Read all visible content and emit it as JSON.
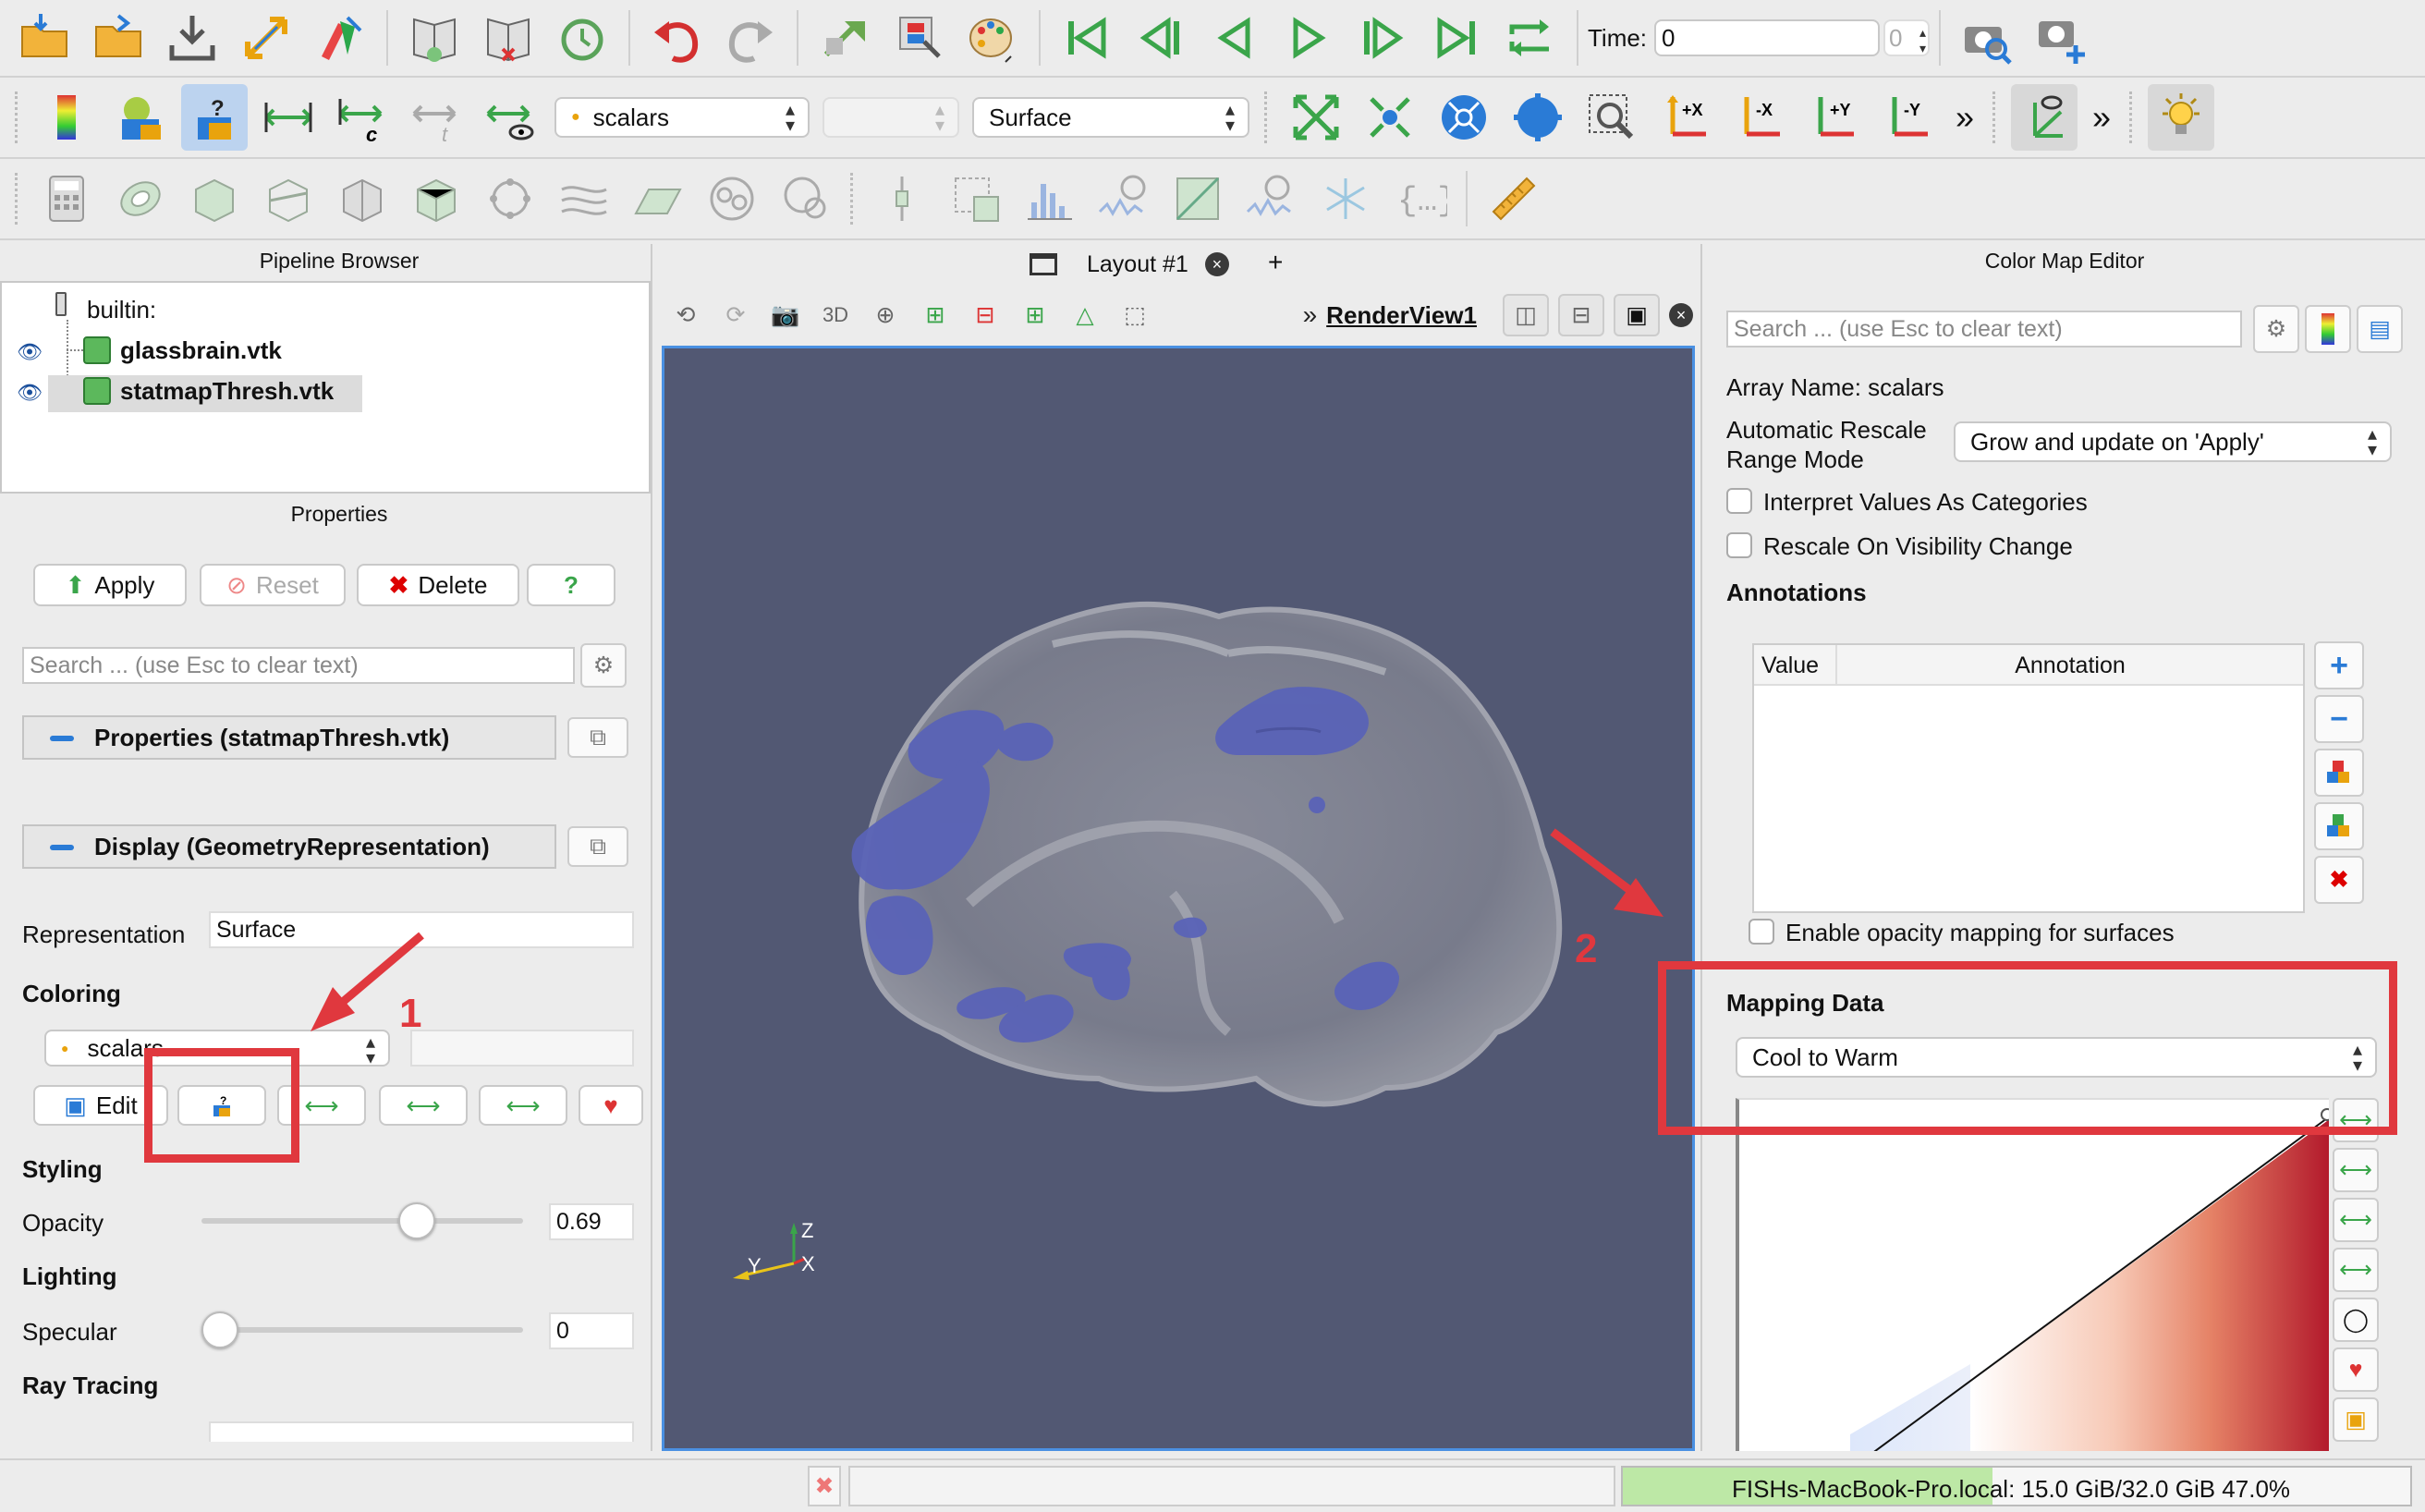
{
  "toolbar": {
    "time_label": "Time:",
    "time_value": "0",
    "time_spin": "0",
    "scalars_combo": "scalars",
    "empty_combo": "",
    "representation_combo": "Surface",
    "more_glyph": "»",
    "axis_buttons": [
      "+X",
      "-X",
      "+Y",
      "-Y"
    ]
  },
  "pipeline": {
    "title": "Pipeline Browser",
    "root": "builtin:",
    "items": [
      "glassbrain.vtk",
      "statmapThresh.vtk"
    ]
  },
  "properties": {
    "title": "Properties",
    "apply": "Apply",
    "reset": "Reset",
    "delete": "Delete",
    "help": "?",
    "search_placeholder": "Search ... (use Esc to clear text)",
    "section_properties": "Properties (statmapThresh.vtk)",
    "section_display": "Display (GeometryRepresentation)",
    "representation_label": "Representation",
    "representation_value": "Surface",
    "coloring_label": "Coloring",
    "coloring_value": "scalars",
    "edit_label": "Edit",
    "styling_label": "Styling",
    "opacity_label": "Opacity",
    "opacity_value": "0.69",
    "opacity_fraction": 0.69,
    "lighting_label": "Lighting",
    "specular_label": "Specular",
    "specular_value": "0",
    "raytracing_label": "Ray Tracing"
  },
  "layout": {
    "tab_label": "Layout #1",
    "add_tab": "+",
    "view_name": "RenderView1",
    "mode_3d": "3D",
    "axes": {
      "z": "Z",
      "y": "Y",
      "x": "X"
    }
  },
  "colormap": {
    "title": "Color Map Editor",
    "search_placeholder": "Search ... (use Esc to clear text)",
    "array_name": "Array Name: scalars",
    "rescale_label_1": "Automatic Rescale",
    "rescale_label_2": "Range Mode",
    "rescale_value": "Grow and update on 'Apply'",
    "interpret_categories": "Interpret Values As Categories",
    "rescale_visibility": "Rescale On Visibility Change",
    "annotations_title": "Annotations",
    "col_value": "Value",
    "col_annotation": "Annotation",
    "enable_opacity": "Enable opacity mapping for surfaces",
    "mapping_title": "Mapping Data",
    "preset": "Cool to Warm"
  },
  "annotations": {
    "marker1": "1",
    "marker2": "2",
    "color": "#e0383e"
  },
  "statusbar": {
    "memory": "FISHs-MacBook-Pro.local: 15.0 GiB/32.0 GiB 47.0%",
    "memory_fraction": 0.47
  },
  "colors": {
    "view_bg": "#525873",
    "blob": "#5a63b7",
    "accent": "#2a7bd6"
  }
}
